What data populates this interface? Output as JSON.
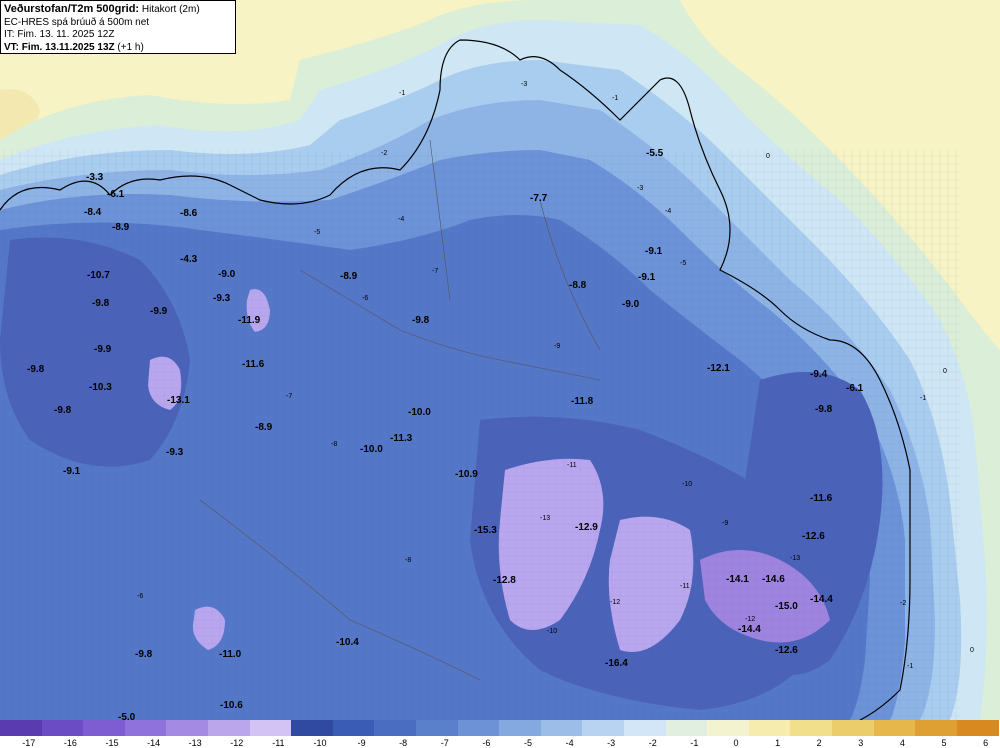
{
  "header": {
    "title_bold": "Veðurstofan/T2m 500grid:",
    "title_rest": "Hitakort (2m)",
    "line2": "EC-HRES spá brúuð á 500m net",
    "line3": "IT: Fim. 13. 11. 2025 12Z",
    "line4_bold": "VT: Fim. 13.11.2025 13Z",
    "line4_rest": "(+1 h)"
  },
  "colors": {
    "sea_warm": "#f7f3c4",
    "coast_band": "#dbeed8",
    "band_0": "#cfe6f4",
    "band_m2": "#a9cdef",
    "band_m4": "#8eb4e6",
    "band_m6": "#6c92d8",
    "band_m8": "#5577c7",
    "band_m10": "#4a62b8",
    "purple_m12": "#b9a6ee",
    "purple_m14": "#9e84df"
  },
  "colorbar": {
    "ticks": [
      "-17",
      "-16",
      "-15",
      "-14",
      "-13",
      "-12",
      "-11",
      "-10",
      "-9",
      "-8",
      "-7",
      "-6",
      "-5",
      "-4",
      "-3",
      "-2",
      "-1",
      "0",
      "1",
      "2",
      "3",
      "4",
      "5",
      "6"
    ],
    "colors": [
      "#5a3bb0",
      "#6c4cc4",
      "#7d5dd1",
      "#8f72dc",
      "#a58ae4",
      "#bba6ec",
      "#d2c3f4",
      "#2f4aa0",
      "#3a5cb4",
      "#4a6dc2",
      "#5a80cc",
      "#6d93d6",
      "#84a8e0",
      "#9dbde9",
      "#b8d3f1",
      "#d2e6f7",
      "#e1efe0",
      "#f3f3cf",
      "#f5ecae",
      "#f1df8c",
      "#eccd6c",
      "#e6b84c",
      "#dea032",
      "#d88a20"
    ]
  },
  "temperature_labels": [
    {
      "text": "-3.3"
    },
    {
      "text": "-6.1"
    },
    {
      "text": "-8.4"
    },
    {
      "text": "-8.9"
    },
    {
      "text": "-10.7"
    },
    {
      "text": "-9.8"
    },
    {
      "text": "-9.9"
    },
    {
      "text": "-9.9"
    },
    {
      "text": "-9.8"
    },
    {
      "text": "-10.3"
    },
    {
      "text": "-9.8"
    },
    {
      "text": "-13.1"
    },
    {
      "text": "-9.3"
    },
    {
      "text": "-9.1"
    },
    {
      "text": "-8.6"
    },
    {
      "text": "-4.3"
    },
    {
      "text": "-9.0"
    },
    {
      "text": "-9.3"
    },
    {
      "text": "-11.9"
    },
    {
      "text": "-11.6"
    },
    {
      "text": "-8.9"
    },
    {
      "text": "-8.9"
    },
    {
      "text": "-9.8"
    },
    {
      "text": "-10.0"
    },
    {
      "text": "-11.3"
    },
    {
      "text": "-10.0"
    },
    {
      "text": "-7.7"
    },
    {
      "text": "-8.8"
    },
    {
      "text": "-9.1"
    },
    {
      "text": "-9.1"
    },
    {
      "text": "-9.0"
    },
    {
      "text": "-5.5"
    },
    {
      "text": "-11.8"
    },
    {
      "text": "-10.9"
    },
    {
      "text": "-15.3"
    },
    {
      "text": "-12.9"
    },
    {
      "text": "-12.8"
    },
    {
      "text": "-12.1"
    },
    {
      "text": "-9.4"
    },
    {
      "text": "-6.1"
    },
    {
      "text": "-9.8"
    },
    {
      "text": "-11.6"
    },
    {
      "text": "-12.6"
    },
    {
      "text": "-14.1"
    },
    {
      "text": "-14.6"
    },
    {
      "text": "-15.0"
    },
    {
      "text": "-14.4"
    },
    {
      "text": "-14.4"
    },
    {
      "text": "-12.6"
    },
    {
      "text": "-16.4"
    },
    {
      "text": "-9.8"
    },
    {
      "text": "-11.0"
    },
    {
      "text": "-10.4"
    },
    {
      "text": "-10.6"
    },
    {
      "text": "-5.0"
    }
  ],
  "isoline_labels": [
    "0",
    "0",
    "0",
    "-1",
    "-1",
    "-1",
    "-1",
    "-2",
    "-2",
    "-3",
    "-3",
    "-4",
    "-4",
    "-5",
    "-5",
    "-6",
    "-6",
    "-7",
    "-7",
    "-8",
    "-8",
    "-9",
    "-9",
    "-10",
    "-10",
    "-11",
    "-11",
    "-12",
    "-12",
    "-13",
    "-13"
  ]
}
